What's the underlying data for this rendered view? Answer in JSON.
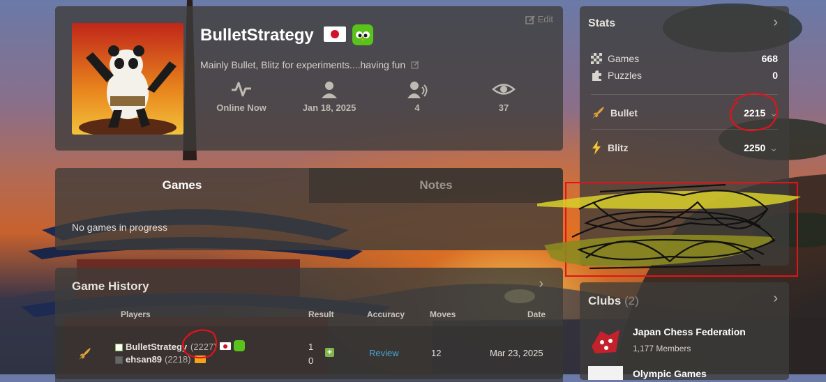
{
  "profile": {
    "username": "BulletStrategy",
    "edit_label": "Edit",
    "bio": "Mainly Bullet, Blitz for experiments....having fun",
    "stats": [
      {
        "icon": "activity-icon",
        "label": "Online Now"
      },
      {
        "icon": "person-icon",
        "label": "Jan 18, 2025"
      },
      {
        "icon": "friends-icon",
        "label": "4"
      },
      {
        "icon": "eye-icon",
        "label": "37"
      }
    ]
  },
  "stats": {
    "title": "Stats",
    "games_label": "Games",
    "games_value": "668",
    "puzzles_label": "Puzzles",
    "puzzles_value": "0",
    "bullet_label": "Bullet",
    "bullet_value": "2215",
    "blitz_label": "Blitz",
    "blitz_value": "2250"
  },
  "tabs": {
    "games": "Games",
    "notes": "Notes",
    "empty": "No games in progress"
  },
  "history": {
    "title": "Game History",
    "columns": [
      "Players",
      "Result",
      "Accuracy",
      "Moves",
      "Date"
    ],
    "row": {
      "player1": "BulletStrategy",
      "player1_rating": "(2227)",
      "player2": "ehsan89",
      "player2_rating": "(2218)",
      "result1": "1",
      "result2": "0",
      "accuracy": "Review",
      "moves": "12",
      "date": "Mar 23, 2025"
    }
  },
  "clubs": {
    "title": "Clubs",
    "count": "(2)",
    "items": [
      {
        "name": "Japan Chess Federation",
        "members": "1,177 Members"
      },
      {
        "name": "Olympic Games",
        "members": ""
      }
    ]
  },
  "colors": {
    "accent_green": "#81b64c",
    "link_blue": "#48a7d6",
    "annotation_red": "#e3121b"
  }
}
